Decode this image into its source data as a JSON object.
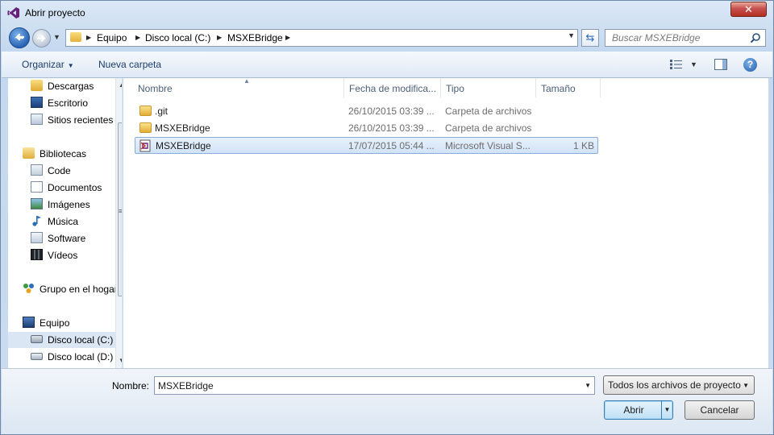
{
  "window": {
    "title": "Abrir proyecto",
    "close_glyph": "✕"
  },
  "address": {
    "crumbs": [
      "Equipo",
      "Disco local (C:)",
      "MSXEBridge"
    ]
  },
  "search": {
    "placeholder": "Buscar MSXEBridge"
  },
  "toolbar": {
    "organize_label": "Organizar",
    "new_folder_label": "Nueva carpeta",
    "help_glyph": "?"
  },
  "sidebar": {
    "items": [
      {
        "label": "Descargas",
        "icon": "downloads-icon"
      },
      {
        "label": "Escritorio",
        "icon": "desktop-icon"
      },
      {
        "label": "Sitios recientes",
        "icon": "recent-places-icon"
      },
      {
        "label": "Bibliotecas",
        "icon": "libraries-icon"
      },
      {
        "label": "Code",
        "icon": "library-folder-icon"
      },
      {
        "label": "Documentos",
        "icon": "documents-icon"
      },
      {
        "label": "Imágenes",
        "icon": "pictures-icon"
      },
      {
        "label": "Música",
        "icon": "music-icon"
      },
      {
        "label": "Software",
        "icon": "library-folder-icon"
      },
      {
        "label": "Vídeos",
        "icon": "videos-icon"
      },
      {
        "label": "Grupo en el hogar",
        "icon": "homegroup-icon"
      },
      {
        "label": "Equipo",
        "icon": "computer-icon"
      },
      {
        "label": "Disco local (C:)",
        "icon": "drive-icon"
      },
      {
        "label": "Disco local (D:)",
        "icon": "drive-icon"
      }
    ]
  },
  "columns": {
    "name": "Nombre",
    "date": "Fecha de modifica...",
    "type": "Tipo",
    "size": "Tamaño"
  },
  "files": [
    {
      "name": ".git",
      "date": "26/10/2015 03:39 ...",
      "type": "Carpeta de archivos",
      "size": "",
      "icon": "folder-icon"
    },
    {
      "name": "MSXEBridge",
      "date": "26/10/2015 03:39 ...",
      "type": "Carpeta de archivos",
      "size": "",
      "icon": "folder-icon"
    },
    {
      "name": "MSXEBridge",
      "date": "17/07/2015 05:44 ...",
      "type": "Microsoft Visual S...",
      "size": "1 KB",
      "icon": "vs-solution-icon"
    }
  ],
  "bottom": {
    "name_label": "Nombre:",
    "name_value": "MSXEBridge",
    "filter_value": "Todos los archivos de proyecto",
    "open_label": "Abrir",
    "cancel_label": "Cancelar"
  },
  "colors": {
    "accent": "#3c7fb1",
    "selection": "#d1e3f7",
    "folder": "#e2ad35"
  }
}
